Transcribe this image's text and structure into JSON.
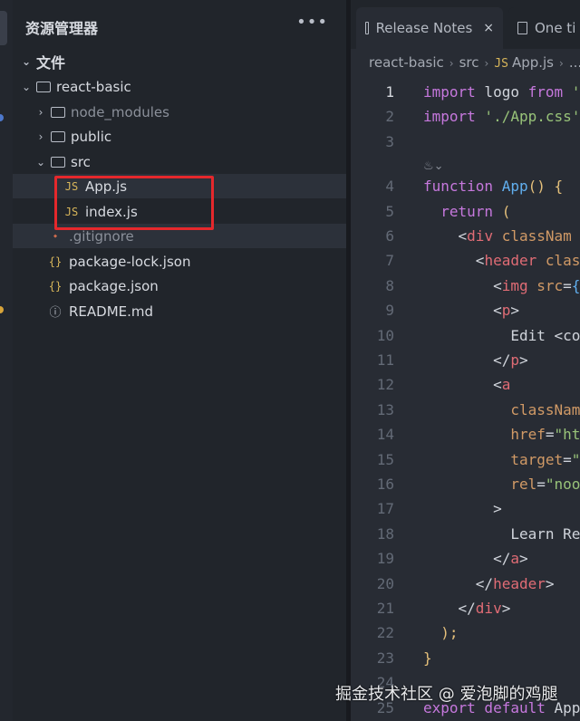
{
  "explorer": {
    "title": "资源管理器",
    "more": "•••",
    "section": "文件",
    "tree": [
      {
        "label": "react-basic",
        "kind": "folder-open",
        "chev": "⌄"
      },
      {
        "label": "node_modules",
        "kind": "folder",
        "chev": "›"
      },
      {
        "label": "public",
        "kind": "folder",
        "chev": "›"
      },
      {
        "label": "src",
        "kind": "folder-open",
        "chev": "⌄"
      },
      {
        "label": "App.js",
        "kind": "js",
        "icon": "JS"
      },
      {
        "label": "index.js",
        "kind": "js",
        "icon": "JS"
      },
      {
        "label": ".gitignore",
        "kind": "git",
        "icon": "⬩"
      },
      {
        "label": "package-lock.json",
        "kind": "json",
        "icon": "{}"
      },
      {
        "label": "package.json",
        "kind": "json",
        "icon": "{}"
      },
      {
        "label": "README.md",
        "kind": "info",
        "icon": "ⓘ"
      }
    ]
  },
  "tabs": [
    {
      "label": "Release Notes",
      "close": "×"
    },
    {
      "label": "One ti"
    }
  ],
  "breadcrumb": {
    "parts": [
      "react-basic",
      "src",
      "App.js",
      "..."
    ],
    "file_icon": "JS"
  },
  "codelens": "♨⌄",
  "code_lines": [
    {
      "n": "1",
      "c": [
        [
          "kw",
          "import"
        ],
        [
          "pl",
          " logo "
        ],
        [
          "kw",
          "from"
        ],
        [
          "str",
          " '"
        ]
      ]
    },
    {
      "n": "2",
      "c": [
        [
          "kw",
          "import"
        ],
        [
          "str",
          " './App.css'"
        ]
      ]
    },
    {
      "n": "3",
      "c": []
    },
    {
      "n": "4",
      "c": [
        [
          "kw",
          "function"
        ],
        [
          "fn",
          " App"
        ],
        [
          "br",
          "()"
        ],
        [
          "pl",
          " "
        ],
        [
          "br",
          "{"
        ]
      ]
    },
    {
      "n": "5",
      "c": [
        [
          "pl",
          "  "
        ],
        [
          "kw",
          "return"
        ],
        [
          "br",
          " ("
        ]
      ]
    },
    {
      "n": "6",
      "c": [
        [
          "pl",
          "    <"
        ],
        [
          "tag",
          "div"
        ],
        [
          "attr",
          " classNam"
        ]
      ]
    },
    {
      "n": "7",
      "c": [
        [
          "pl",
          "      <"
        ],
        [
          "tag",
          "header"
        ],
        [
          "attr",
          " clas"
        ]
      ]
    },
    {
      "n": "8",
      "c": [
        [
          "pl",
          "        <"
        ],
        [
          "tag",
          "img"
        ],
        [
          "attr",
          " src"
        ],
        [
          "pl",
          "="
        ],
        [
          "fn",
          "{"
        ]
      ]
    },
    {
      "n": "9",
      "c": [
        [
          "pl",
          "        <"
        ],
        [
          "tag",
          "p"
        ],
        [
          "pl",
          ">"
        ]
      ]
    },
    {
      "n": "10",
      "c": [
        [
          "pl",
          "          Edit <co"
        ]
      ]
    },
    {
      "n": "11",
      "c": [
        [
          "pl",
          "        </"
        ],
        [
          "tag",
          "p"
        ],
        [
          "pl",
          ">"
        ]
      ]
    },
    {
      "n": "12",
      "c": [
        [
          "pl",
          "        <"
        ],
        [
          "tag",
          "a"
        ]
      ]
    },
    {
      "n": "13",
      "c": [
        [
          "attr",
          "          classNam"
        ]
      ]
    },
    {
      "n": "14",
      "c": [
        [
          "attr",
          "          href"
        ],
        [
          "pl",
          "="
        ],
        [
          "str",
          "\"ht"
        ]
      ]
    },
    {
      "n": "15",
      "c": [
        [
          "attr",
          "          target"
        ],
        [
          "pl",
          "="
        ],
        [
          "str",
          "\""
        ]
      ]
    },
    {
      "n": "16",
      "c": [
        [
          "attr",
          "          rel"
        ],
        [
          "pl",
          "="
        ],
        [
          "str",
          "\"noo"
        ]
      ]
    },
    {
      "n": "17",
      "c": [
        [
          "pl",
          "        >"
        ]
      ]
    },
    {
      "n": "18",
      "c": [
        [
          "pl",
          "          Learn Re"
        ]
      ]
    },
    {
      "n": "19",
      "c": [
        [
          "pl",
          "        </"
        ],
        [
          "tag",
          "a"
        ],
        [
          "pl",
          ">"
        ]
      ]
    },
    {
      "n": "20",
      "c": [
        [
          "pl",
          "      </"
        ],
        [
          "tag",
          "header"
        ],
        [
          "pl",
          ">"
        ]
      ]
    },
    {
      "n": "21",
      "c": [
        [
          "pl",
          "    </"
        ],
        [
          "tag",
          "div"
        ],
        [
          "pl",
          ">"
        ]
      ]
    },
    {
      "n": "22",
      "c": [
        [
          "br",
          "  );"
        ]
      ]
    },
    {
      "n": "23",
      "c": [
        [
          "br",
          "}"
        ]
      ]
    },
    {
      "n": "24",
      "c": []
    },
    {
      "n": "25",
      "c": [
        [
          "kw",
          "export"
        ],
        [
          "kw",
          " default"
        ],
        [
          "pl",
          " App"
        ]
      ]
    }
  ],
  "watermark": "掘金技术社区 @ 爱泡脚的鸡腿"
}
